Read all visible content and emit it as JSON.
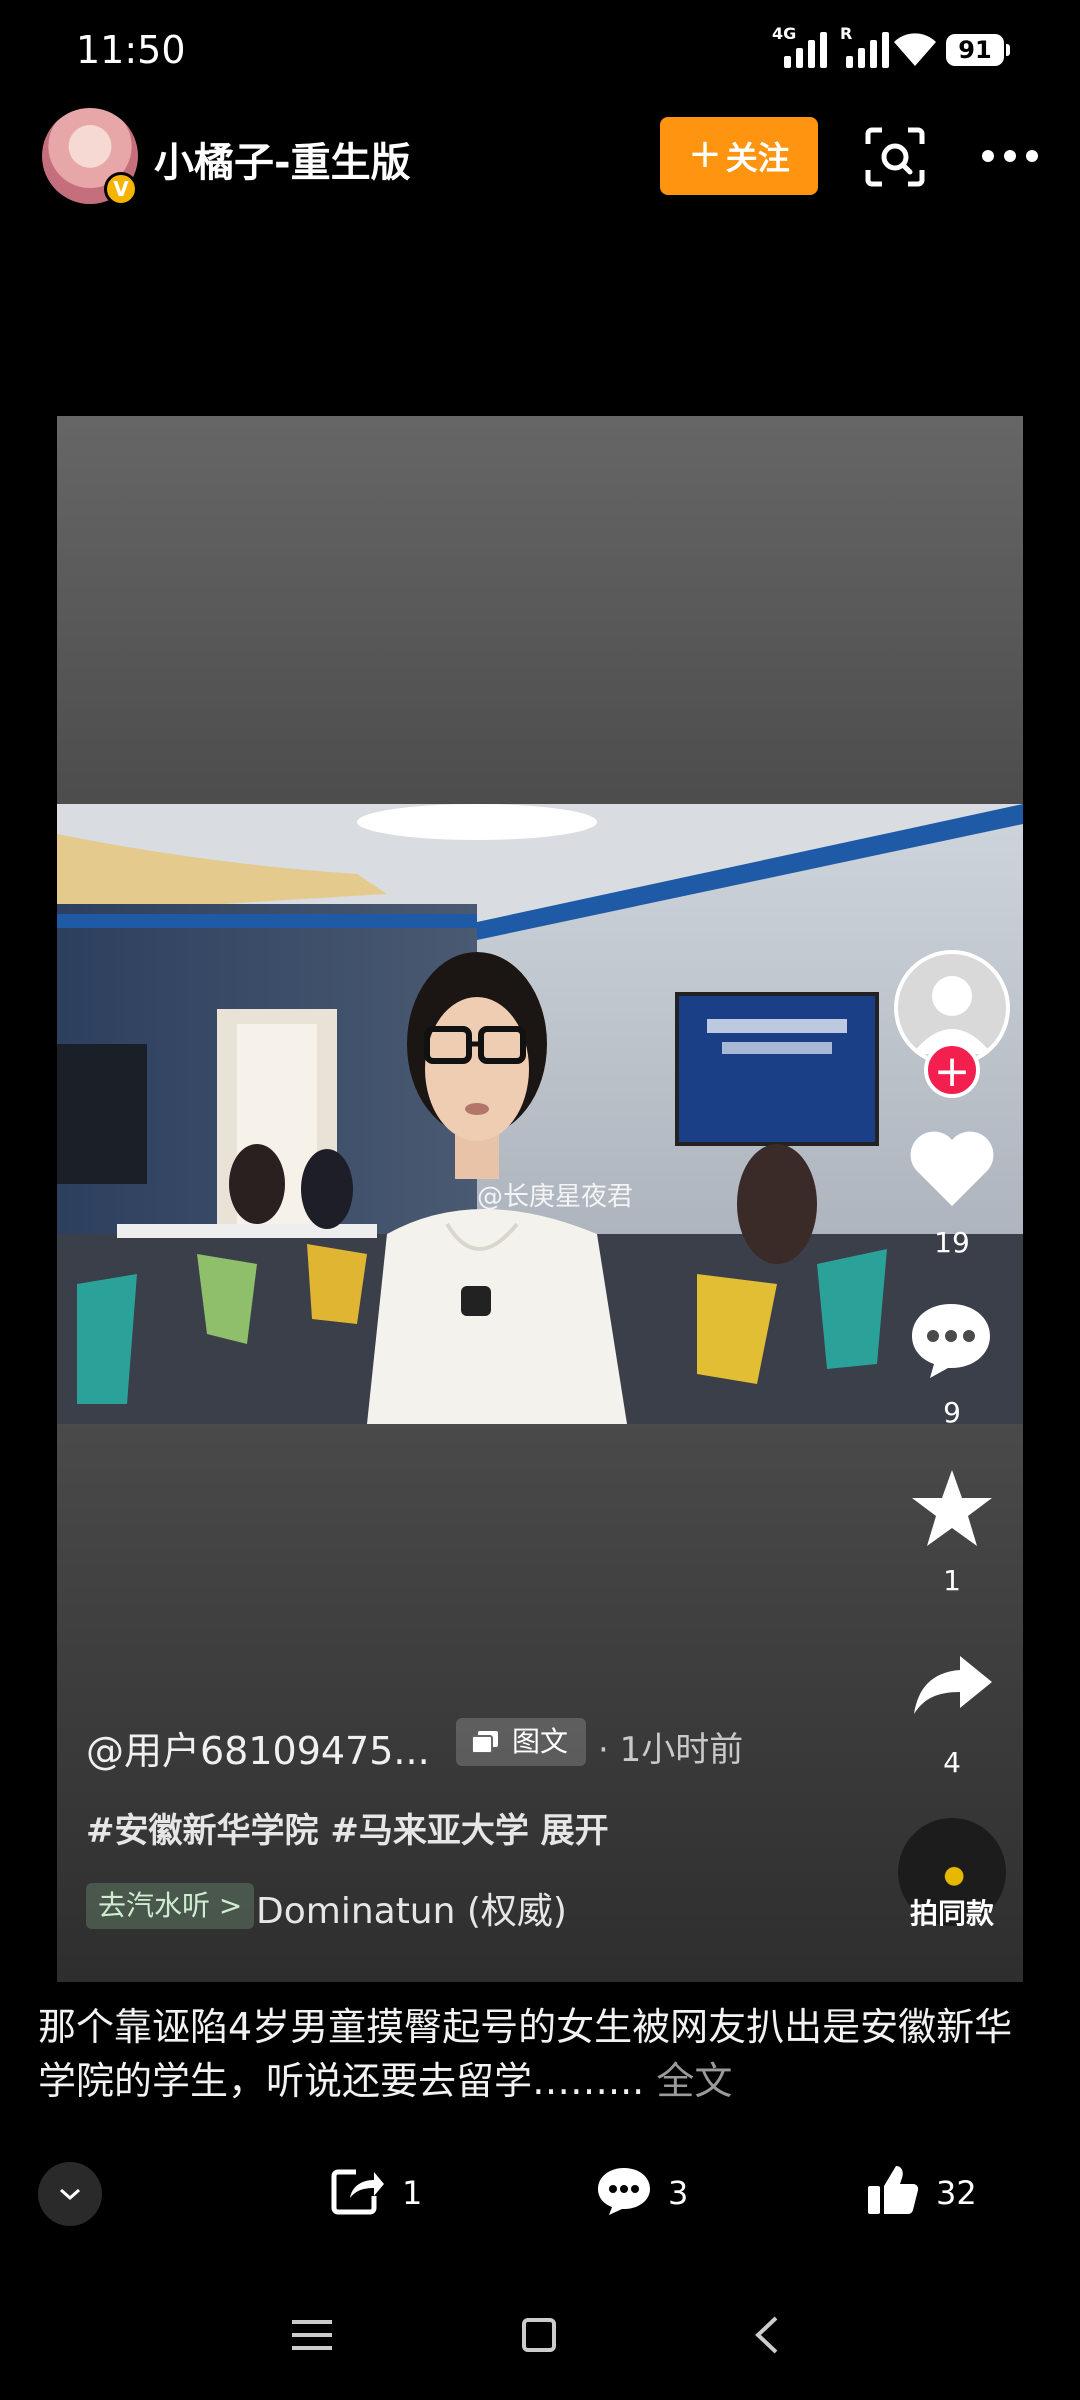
{
  "status_bar": {
    "time": "11:50",
    "network": "4G",
    "roaming": "R",
    "battery": "91"
  },
  "header": {
    "username": "小橘子-重生版",
    "verified_badge": "V",
    "follow_label": "关注",
    "follow_plus": "+",
    "icons": [
      "scan-icon",
      "more-icon"
    ]
  },
  "media": {
    "watermark": "@长庚星夜君"
  },
  "rail": {
    "follow_plus": "+",
    "likes": "19",
    "comments": "9",
    "favorites": "1",
    "shares": "4",
    "record_label": "拍同款"
  },
  "caption": {
    "author": "@用户68109475...",
    "type_chip": "图文",
    "time_ago": "· 1小时前",
    "hashtags": "#安徽新华学院 #马来亚大学  展开",
    "music_chip": "去汽水听 >",
    "music_title": "Dominatun (权威)"
  },
  "post": {
    "text": "那个靠诬陷4岁男童摸臀起号的女生被网友扒出是安徽新华学院的学生，听说还要去留学……...",
    "more": "全文"
  },
  "actions": {
    "reposts": "1",
    "comments": "3",
    "likes": "32"
  },
  "colors": {
    "follow_orange": "#ff9410",
    "plus_red": "#f3204f",
    "badge_gold": "#f5b400"
  }
}
